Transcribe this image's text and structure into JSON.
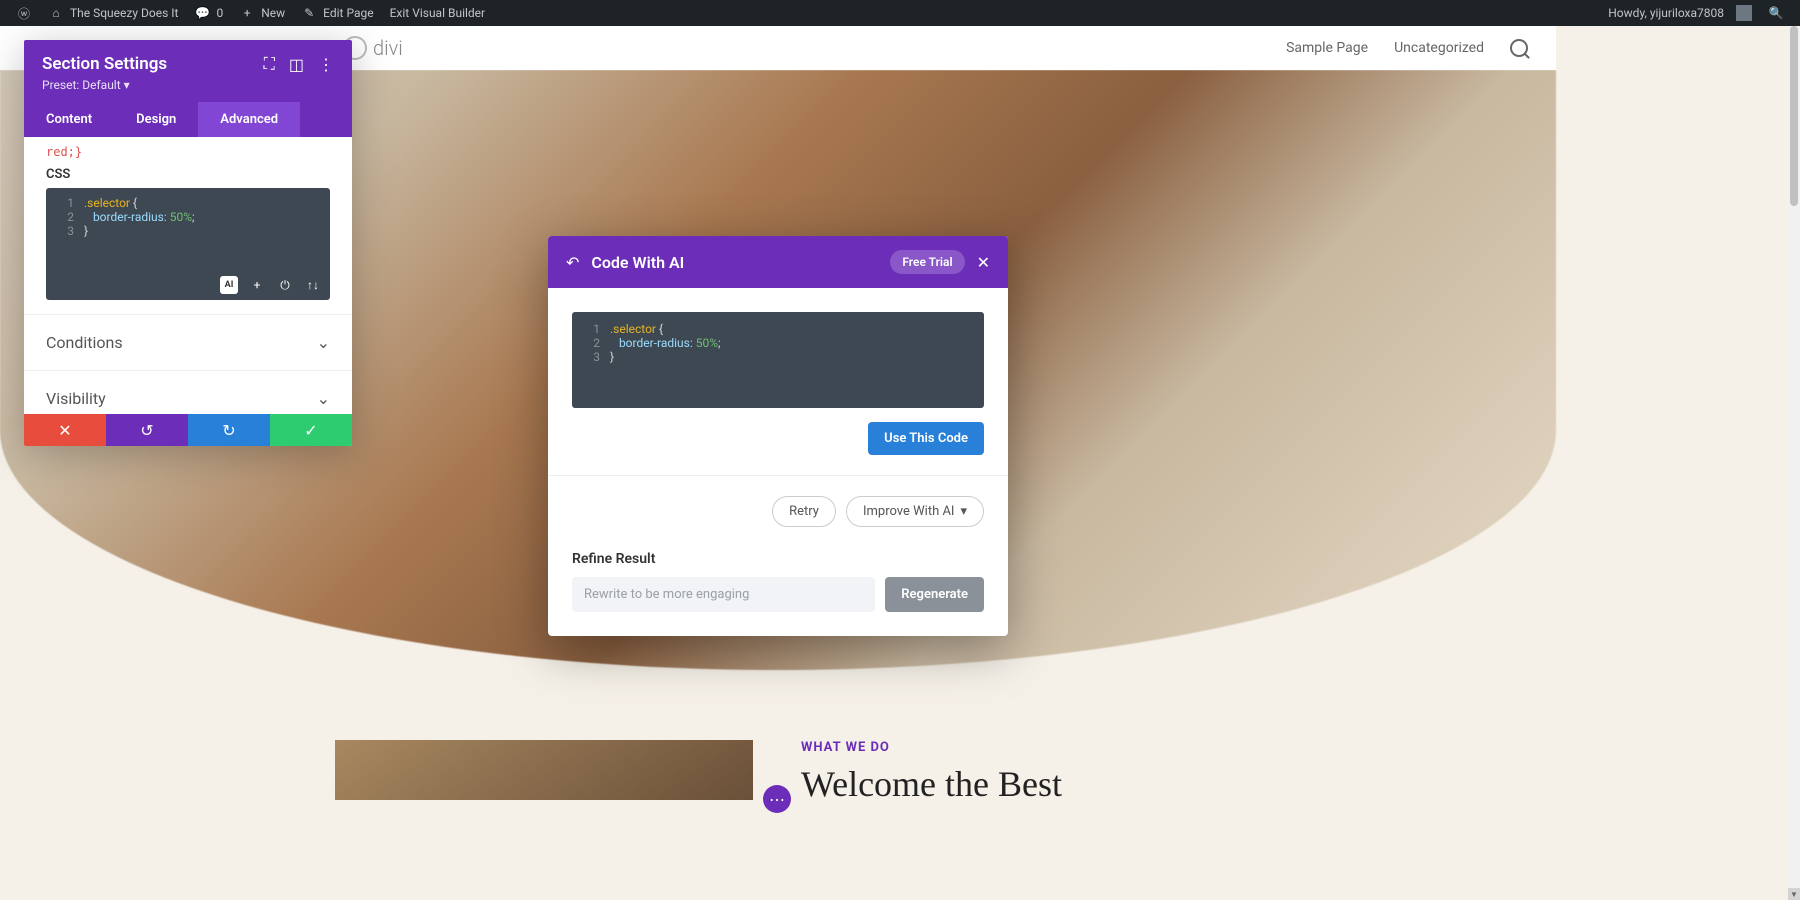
{
  "wp_bar": {
    "site_name": "The Squeezy Does It",
    "comments": "0",
    "new": "New",
    "edit": "Edit Page",
    "exit": "Exit Visual Builder",
    "howdy": "Howdy, yijuriloxa7808"
  },
  "header": {
    "logo": "divi",
    "nav": [
      "Sample Page",
      "Uncategorized"
    ]
  },
  "panel": {
    "title": "Section Settings",
    "preset": "Preset: Default ▾",
    "tabs": [
      "Content",
      "Design",
      "Advanced"
    ],
    "active_tab": 2,
    "code_hint": "red;}",
    "css_label": "CSS",
    "code_lines": [
      {
        "n": "1",
        "sel": ".selector",
        "brace": " {"
      },
      {
        "n": "2",
        "prop": "border-radius:",
        "val": " 50%",
        "semi": ";"
      },
      {
        "n": "3",
        "brace": "}"
      }
    ],
    "accordions": [
      "Conditions",
      "Visibility"
    ]
  },
  "modal": {
    "title": "Code With AI",
    "free_trial": "Free Trial",
    "code_lines": [
      {
        "n": "1",
        "sel": ".selector",
        "brace": " {"
      },
      {
        "n": "2",
        "prop": "border-radius:",
        "val": " 50%",
        "semi": ";"
      },
      {
        "n": "3",
        "brace": "}"
      }
    ],
    "use_code": "Use This Code",
    "retry": "Retry",
    "improve": "Improve With AI",
    "refine_label": "Refine Result",
    "refine_placeholder": "Rewrite to be more engaging",
    "regenerate": "Regenerate"
  },
  "below": {
    "eyebrow": "WHAT WE DO",
    "headline": "Welcome the Best"
  },
  "colors": {
    "purple": "#6c2eb9",
    "blue": "#2980d9",
    "green": "#2ecc71",
    "red": "#e74c3c"
  }
}
